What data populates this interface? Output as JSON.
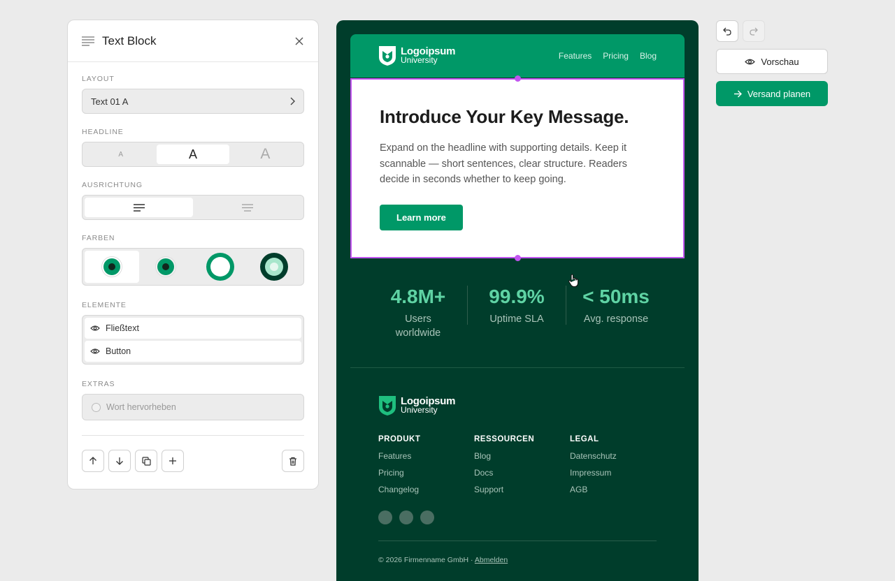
{
  "panel": {
    "title": "Text Block",
    "layout_label": "LAYOUT",
    "layout_value": "Text 01 A",
    "headline_label": "HEADLINE",
    "headline_options": [
      "A",
      "A",
      "A"
    ],
    "alignment_label": "AUSRICHTUNG",
    "colors_label": "FARBEN",
    "elements_label": "ELEMENTE",
    "elements": [
      "Fließtext",
      "Button"
    ],
    "extras_label": "EXTRAS",
    "extras_option": "Wort hervorheben",
    "color_swatches": [
      "#009867",
      "#003d2b",
      "#ffffff",
      "#a8e6cc"
    ]
  },
  "email": {
    "header": {
      "logo_name": "Logoipsum",
      "logo_sub": "University",
      "nav": [
        "Features",
        "Pricing",
        "Blog"
      ]
    },
    "hero": {
      "headline": "Introduce Your Key Message.",
      "body": "Expand on the headline with supporting details. Keep it scannable — short sentences, clear structure. Readers decide in seconds whether to keep going.",
      "cta": "Learn more"
    },
    "stats": [
      {
        "value": "4.8M+",
        "label": "Users worldwide"
      },
      {
        "value": "99.9%",
        "label": "Uptime SLA"
      },
      {
        "value": "< 50ms",
        "label": "Avg. response"
      }
    ],
    "footer": {
      "logo_name": "Logoipsum",
      "logo_sub": "University",
      "columns": [
        {
          "heading": "PRODUKT",
          "links": [
            "Features",
            "Pricing",
            "Changelog"
          ]
        },
        {
          "heading": "RESSOURCEN",
          "links": [
            "Blog",
            "Docs",
            "Support"
          ]
        },
        {
          "heading": "LEGAL",
          "links": [
            "Datenschutz",
            "Impressum",
            "AGB"
          ]
        }
      ],
      "copyright": "© 2026 Firmenname GmbH · ",
      "unsubscribe": "Abmelden"
    },
    "colors": {
      "brand": "#009867",
      "dark": "#003d2b",
      "accent": "#5fd3a4",
      "selection": "#c255f0"
    }
  },
  "toolbar": {
    "preview_label": "Vorschau",
    "schedule_label": "Versand planen"
  }
}
